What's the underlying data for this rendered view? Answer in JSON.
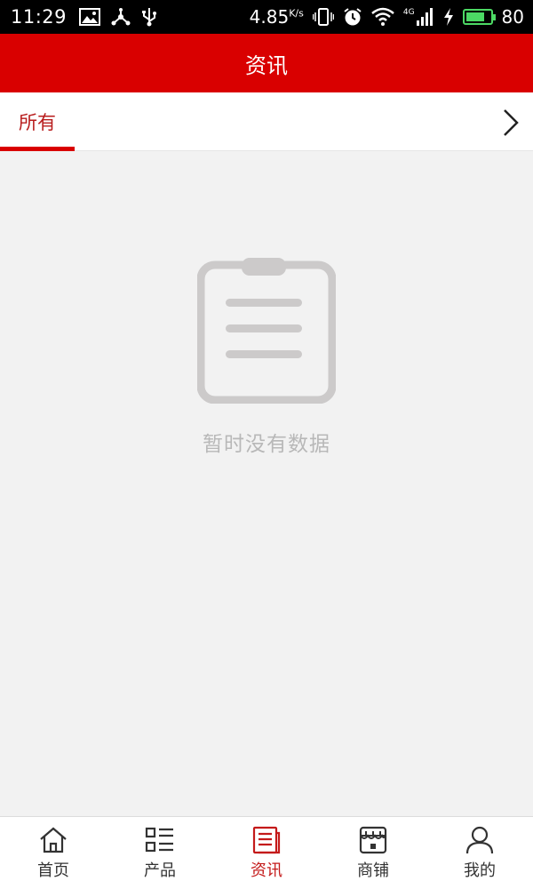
{
  "status_bar": {
    "time": "11:29",
    "network_speed": "4.85",
    "speed_unit": "K/s",
    "network_type": "4G",
    "battery_level": "80",
    "battery_fraction": 0.8
  },
  "header": {
    "title": "资讯"
  },
  "tabs": [
    {
      "label": "所有",
      "active": true
    }
  ],
  "empty_state": {
    "message": "暂时没有数据"
  },
  "bottom_nav": [
    {
      "label": "首页",
      "icon": "home-icon"
    },
    {
      "label": "产品",
      "icon": "product-list-icon"
    },
    {
      "label": "资讯",
      "icon": "news-icon",
      "active": true
    },
    {
      "label": "商铺",
      "icon": "store-icon"
    },
    {
      "label": "我的",
      "icon": "user-icon"
    }
  ],
  "colors": {
    "brand_red": "#d90000",
    "active_text": "#c41a1a",
    "empty_icon": "#cccaca",
    "empty_text": "#b8b8b8",
    "background": "#f2f2f2"
  }
}
